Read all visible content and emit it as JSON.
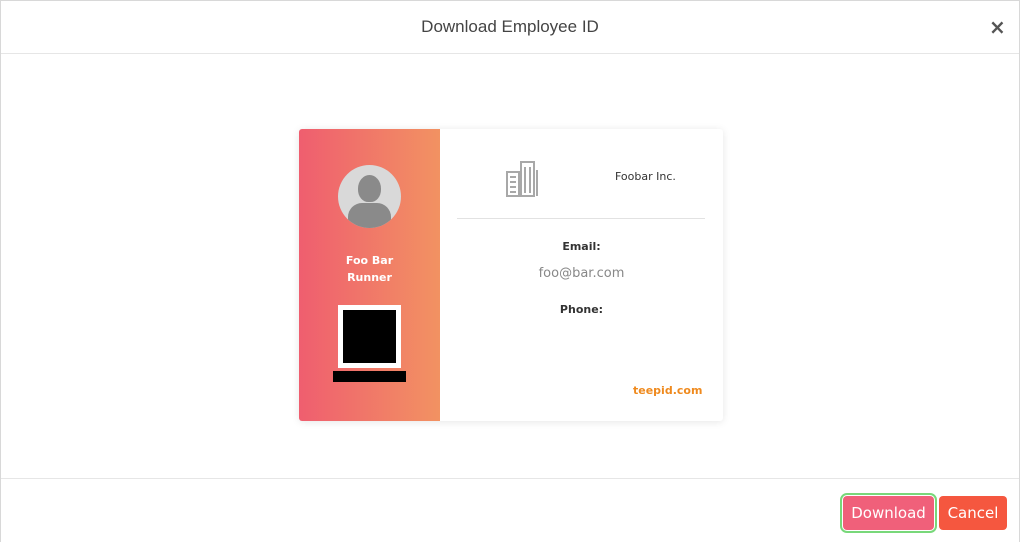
{
  "modal": {
    "title": "Download Employee ID",
    "close_label": "×"
  },
  "card": {
    "employee": {
      "name": "Foo Bar",
      "role": "Runner"
    },
    "company": {
      "name": "Foobar Inc.",
      "icon": "building-icon"
    },
    "email_label": "Email:",
    "email_value": "foo@bar.com",
    "phone_label": "Phone:",
    "phone_value": "",
    "website": "teepid.com",
    "colors": {
      "gradient_start": "#ef5e6f",
      "gradient_end": "#f29262",
      "website": "#ef8a1e"
    }
  },
  "footer": {
    "download_label": "Download",
    "cancel_label": "Cancel"
  }
}
